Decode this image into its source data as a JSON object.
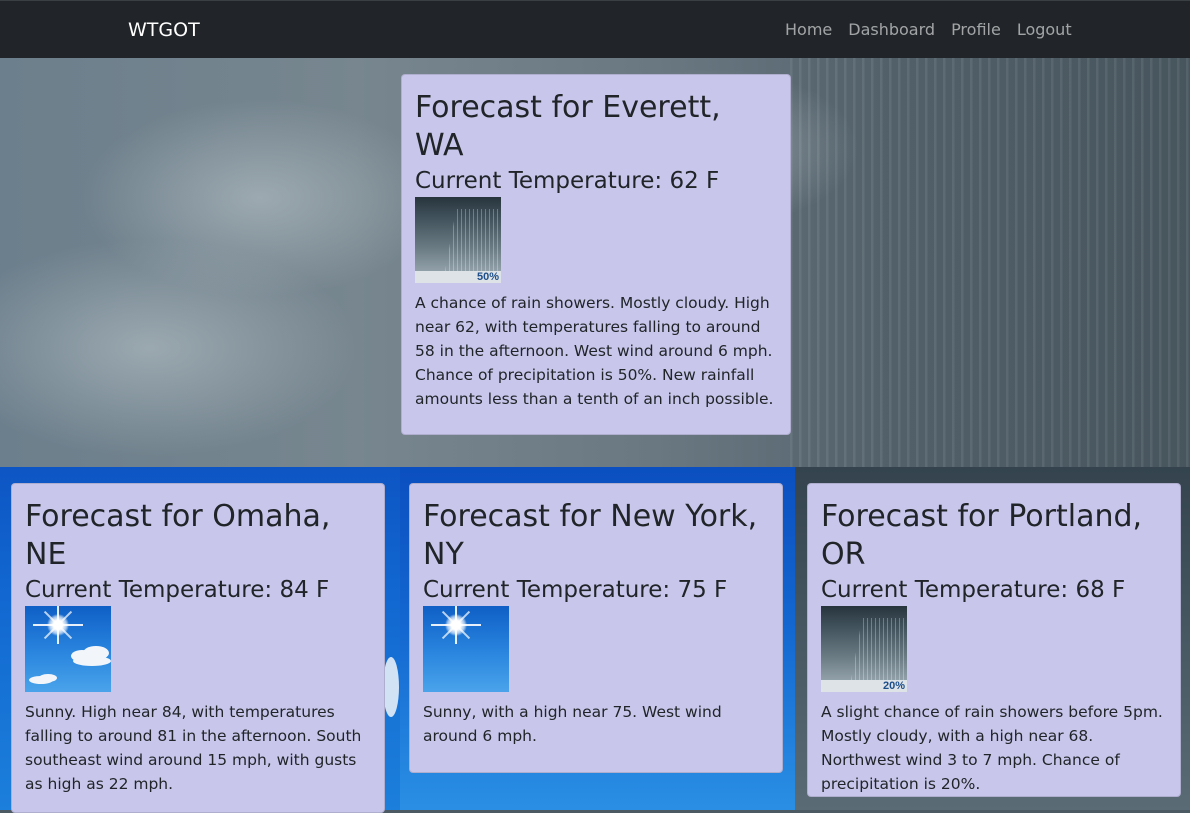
{
  "navbar": {
    "brand": "WTGOT",
    "links": [
      "Home",
      "Dashboard",
      "Profile",
      "Logout"
    ]
  },
  "forecasts": [
    {
      "title": "Forecast for Everett, WA",
      "temperature": "Current Temperature: 62 F",
      "icon": "rain-showers-icon",
      "precip_label": "50%",
      "description": "A chance of rain showers. Mostly cloudy. High near 62, with temperatures falling to around 58 in the afternoon. West wind around 6 mph. Chance of precipitation is 50%. New rainfall amounts less than a tenth of an inch possible."
    },
    {
      "title": "Forecast for Omaha, NE",
      "temperature": "Current Temperature: 84 F",
      "icon": "sunny-with-clouds-icon",
      "description": "Sunny. High near 84, with temperatures falling to around 81 in the afternoon. South southeast wind around 15 mph, with gusts as high as 22 mph."
    },
    {
      "title": "Forecast for New York, NY",
      "temperature": "Current Temperature: 75 F",
      "icon": "sunny-icon",
      "description": "Sunny, with a high near 75. West wind around 6 mph."
    },
    {
      "title": "Forecast for Portland, OR",
      "temperature": "Current Temperature: 68 F",
      "icon": "rain-showers-icon",
      "precip_label": "20%",
      "description": "A slight chance of rain showers before 5pm. Mostly cloudy, with a high near 68. Northwest wind 3 to 7 mph. Chance of precipitation is 20%."
    }
  ],
  "colors": {
    "navbar": "#212529",
    "card": "#c8c7eb",
    "nav_link": "#9a9da0"
  }
}
